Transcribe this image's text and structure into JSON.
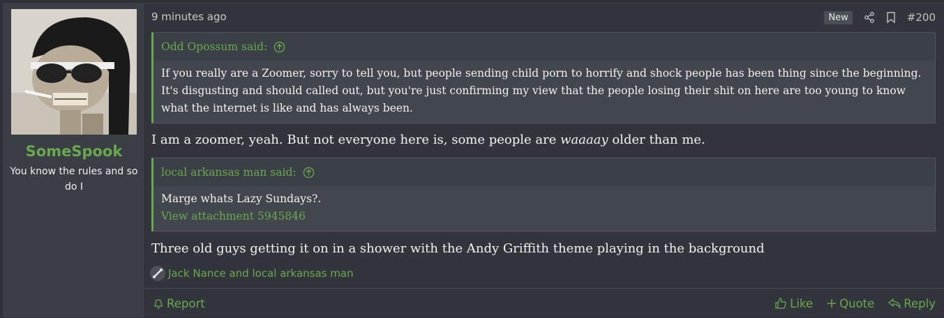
{
  "user": {
    "username": "SomeSpook",
    "title": "You know the rules and so do I",
    "avatar_icon": "skeleton-avatar"
  },
  "post": {
    "timestamp": "9 minutes ago",
    "new_badge": "New",
    "post_number": "#200",
    "quotes": [
      {
        "author": "Odd Opossum said:",
        "text": "If you really are a Zoomer, sorry to tell you, but people sending child porn to horrify and shock people has been thing since the beginning. It's disgusting and should called out, but you're just confirming my view that the people losing their shit on here are too young to know what the internet is like and has always been."
      },
      {
        "author": "local arkansas man said:",
        "text": "Marge whats Lazy Sundays?.",
        "attachment": "View attachment 5945846"
      }
    ],
    "reply_1_before": "I am a zoomer, yeah. But not everyone here is, some people are ",
    "reply_1_italic": "waaaay",
    "reply_1_after": " older than me.",
    "reply_2": "Three old guys getting it on in a shower with the Andy Griffith theme playing in the background",
    "reactions": "Jack Nance and local arkansas man"
  },
  "footer": {
    "report": "Report",
    "like": "Like",
    "quote": "Quote",
    "reply": "Reply"
  },
  "colors": {
    "accent": "#6aa84f",
    "background": "#32363c",
    "quote_bg": "#42464d"
  }
}
